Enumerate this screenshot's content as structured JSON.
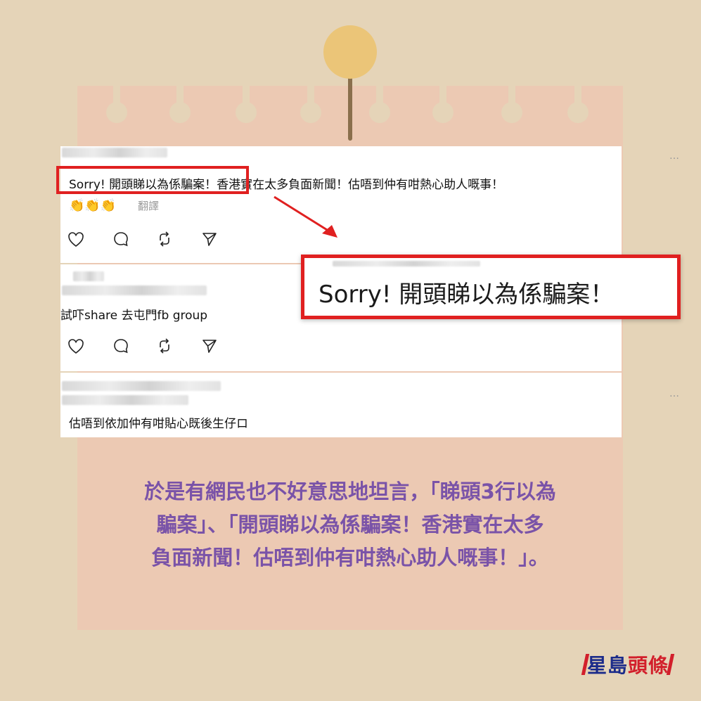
{
  "posts": [
    {
      "text_highlight": "Sorry! 開頭睇以為係騙案！",
      "text_rest": "香港實在太多負面新聞！估唔到仲有咁熱心助人嘅事！",
      "emoji": "👏👏👏",
      "translate_label": "翻譯",
      "more": "…"
    },
    {
      "text": "試吓share 去屯門fb group"
    },
    {
      "text": "估唔到依加仲有咁貼心既後生仔ロ",
      "more": "…"
    }
  ],
  "zoom_text": "Sorry! 開頭睇以為係騙案！",
  "caption_lines": [
    "於是有網民也不好意思地坦言，「睇頭3行以為",
    "騙案」、「開頭睇以為係騙案！香港實在太多",
    "負面新聞！估唔到仲有咁熱心助人嘅事！」。"
  ],
  "logo": {
    "part1": "星島",
    "part2": "頭條"
  },
  "colors": {
    "highlight": "#e02020",
    "caption": "#7a53a8",
    "background": "#e5d4b8",
    "paper": "#ecc9b3"
  },
  "icons": [
    "heart-icon",
    "comment-icon",
    "repost-icon",
    "share-icon"
  ]
}
